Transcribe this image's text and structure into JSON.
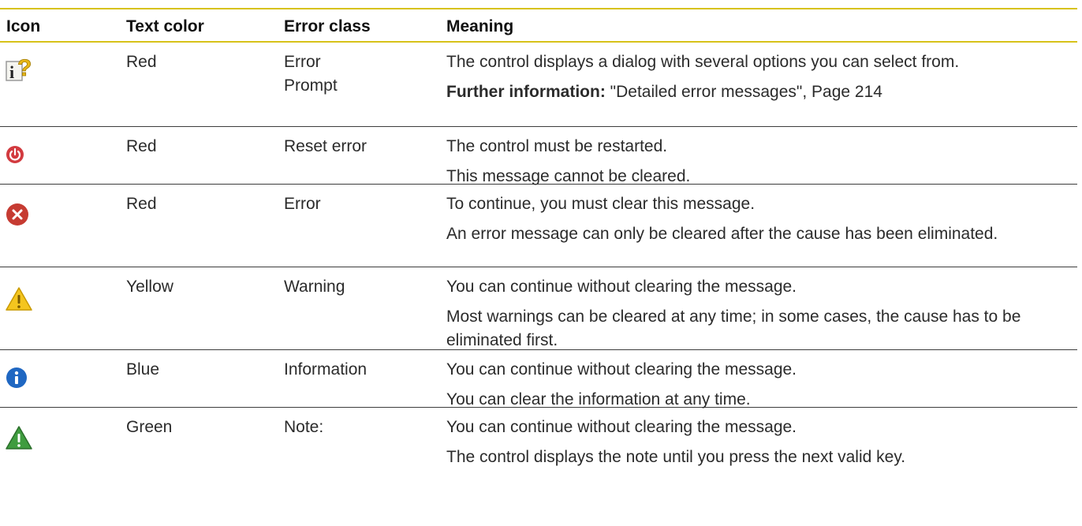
{
  "headers": {
    "icon": "Icon",
    "text_color": "Text color",
    "error_class": "Error class",
    "meaning": "Meaning"
  },
  "rows": [
    {
      "icon": "info-question-icon",
      "text_color": "Red",
      "error_class": [
        "Error",
        "Prompt"
      ],
      "meaning": [
        "The control displays a dialog with several options you can select from."
      ],
      "further_label": "Further information:",
      "further_text": " \"Detailed error messages\", Page 214"
    },
    {
      "icon": "power-reset-icon",
      "text_color": "Red",
      "error_class": [
        "Reset error"
      ],
      "meaning": [
        "The control must be restarted.",
        "This message cannot be cleared."
      ]
    },
    {
      "icon": "error-x-icon",
      "text_color": "Red",
      "error_class": [
        "Error"
      ],
      "meaning": [
        "To continue, you must clear this message.",
        "An error message can only be cleared after the cause has been eliminated."
      ]
    },
    {
      "icon": "warning-yellow-icon",
      "text_color": "Yellow",
      "error_class": [
        "Warning"
      ],
      "meaning": [
        "You can continue without clearing the message.",
        "Most warnings can be cleared at any time; in some cases, the cause has to be eliminated first."
      ]
    },
    {
      "icon": "info-blue-icon",
      "text_color": "Blue",
      "error_class": [
        "Information"
      ],
      "meaning": [
        "You can continue without clearing the message.",
        "You can clear the information at any time."
      ]
    },
    {
      "icon": "warning-green-icon",
      "text_color": "Green",
      "error_class": [
        "Note:"
      ],
      "meaning": [
        "You can continue without clearing the message.",
        "The control displays the note until you press the next valid key."
      ]
    }
  ],
  "colors": {
    "rule_header": "#d7c21a",
    "rule_row": "#3c3c3c",
    "red": "#c8262b",
    "yellow": "#f1c40f",
    "blue": "#1565c0",
    "green": "#3c9a3c"
  }
}
